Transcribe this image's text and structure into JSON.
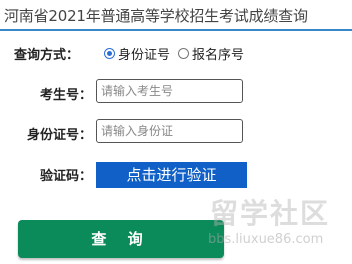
{
  "header": {
    "title": "河南省2021年普通高等学校招生考试成绩查询"
  },
  "form": {
    "query_method_label": "查询方式：",
    "query_options": [
      {
        "label": "身份证号",
        "checked": true
      },
      {
        "label": "报名序号",
        "checked": false
      }
    ],
    "exam_number_label": "考生号：",
    "exam_number_placeholder": "请输入考生号",
    "id_number_label": "身份证号：",
    "id_number_placeholder": "请输入身份证",
    "captcha_label": "验证码：",
    "verify_button_label": "点击进行验证",
    "submit_button_label": "查 询"
  },
  "watermark": {
    "logo_text": "留学社区",
    "url_text": "bbs.liuxue86.com"
  },
  "colors": {
    "verify_button": "#1160c8",
    "submit_button": "#0b8a5a",
    "title_underline": "#3a87c8",
    "radio_accent": "#2b6fd6"
  }
}
